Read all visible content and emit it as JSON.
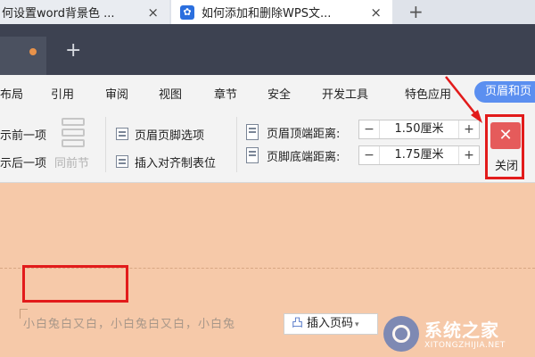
{
  "browser_tabs": [
    {
      "title": "何设置word背景色 ...",
      "close": "×"
    },
    {
      "title": "如何添加和删除WPS文...",
      "close": "×"
    }
  ],
  "new_tab_symbol": "+",
  "wps_new_tab_symbol": "+",
  "menu": [
    "布局",
    "引用",
    "审阅",
    "视图",
    "章节",
    "安全",
    "开发工具",
    "特色应用",
    "页眉和页"
  ],
  "toolbar": {
    "prev_item": "示前一项",
    "next_item": "示后一项",
    "same_as_previous": "同前节",
    "hf_options": "页眉页脚选项",
    "insert_tab": "插入对齐制表位",
    "header_top_label": "页眉顶端距离:",
    "header_top_value": "1.50厘米",
    "footer_bottom_label": "页脚底端距离:",
    "footer_bottom_value": "1.75厘米",
    "minus": "−",
    "plus": "+",
    "close_icon": "✕",
    "close_label": "关闭"
  },
  "document": {
    "body_text": "小白兔白又白，小白兔白又白，小白兔",
    "insert_page_number": "插入页码",
    "page_icon": "凸"
  },
  "watermark": {
    "name": "系统之家",
    "url": "XITONGZHIJIA.NET"
  },
  "colors": {
    "accent": "#5b8ff0",
    "annotation": "#e21b1b",
    "document_bg": "#f6c9a9",
    "close_button": "#e55b5b"
  }
}
